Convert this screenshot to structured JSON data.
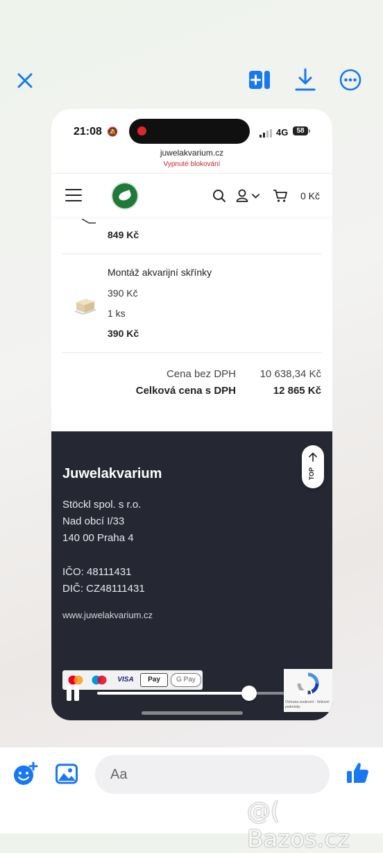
{
  "viewer": {
    "close_icon": "close-icon",
    "actions": [
      "add-to-album-icon",
      "download-icon",
      "more-icon"
    ]
  },
  "phone_status": {
    "time": "21:08",
    "network": "4G",
    "battery": "58"
  },
  "browser": {
    "url": "juwelakvarium.cz",
    "blocking_label": "Vypnuté blokování"
  },
  "site_header": {
    "cart_total": "0 Kč"
  },
  "cart": {
    "previous_item_price": "849 Kč",
    "item": {
      "name": "Montáž akvarijní skřínky",
      "unit_price": "390 Kč",
      "quantity": "1 ks",
      "total": "390 Kč"
    },
    "summary": {
      "without_vat_label": "Cena bez DPH",
      "without_vat_value": "10 638,34 Kč",
      "with_vat_label": "Celková cena s DPH",
      "with_vat_value": "12 865 Kč"
    }
  },
  "footer": {
    "brand": "Juwelakvarium",
    "company": "Stöckl spol. s r.o.",
    "street": "Nad obcí I/33",
    "city": "140 00 Praha 4",
    "ico": "IČO: 48111431",
    "dic": "DIČ: CZ48111431",
    "website": "www.juwelakvarium.cz",
    "top_button": "TOP",
    "payments": [
      "VISA",
      "Pay",
      "G Pay"
    ],
    "recaptcha_text": "Ochrana soukromí - Smluvní podmínky"
  },
  "video": {
    "progress": 0.81
  },
  "messenger": {
    "input_placeholder": "Aa"
  },
  "watermark": "@( Bazos.cz",
  "colors": {
    "accent": "#1877f2",
    "footer_bg": "#252833",
    "recording": "#e0262b",
    "blocking": "#c0262d"
  }
}
